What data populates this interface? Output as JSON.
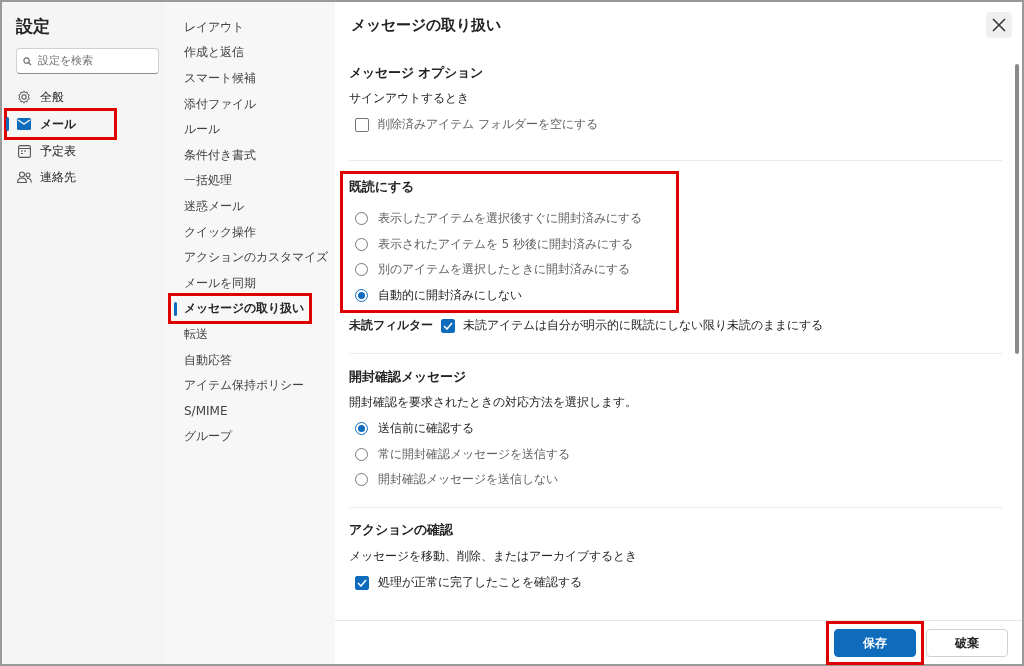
{
  "sidebar": {
    "title": "設定",
    "search": {
      "placeholder": "設定を検索"
    },
    "items": [
      {
        "label": "全般",
        "selected": false,
        "highlighted": false
      },
      {
        "label": "メール",
        "selected": true,
        "highlighted": true
      },
      {
        "label": "予定表",
        "selected": false,
        "highlighted": false
      },
      {
        "label": "連絡先",
        "selected": false,
        "highlighted": false
      }
    ]
  },
  "subnav": {
    "items": [
      {
        "label": "レイアウト",
        "selected": false,
        "highlighted": false
      },
      {
        "label": "作成と返信",
        "selected": false,
        "highlighted": false
      },
      {
        "label": "スマート候補",
        "selected": false,
        "highlighted": false
      },
      {
        "label": "添付ファイル",
        "selected": false,
        "highlighted": false
      },
      {
        "label": "ルール",
        "selected": false,
        "highlighted": false
      },
      {
        "label": "条件付き書式",
        "selected": false,
        "highlighted": false
      },
      {
        "label": "一括処理",
        "selected": false,
        "highlighted": false
      },
      {
        "label": "迷惑メール",
        "selected": false,
        "highlighted": false
      },
      {
        "label": "クイック操作",
        "selected": false,
        "highlighted": false
      },
      {
        "label": "アクションのカスタマイズ",
        "selected": false,
        "highlighted": false
      },
      {
        "label": "メールを同期",
        "selected": false,
        "highlighted": false
      },
      {
        "label": "メッセージの取り扱い",
        "selected": true,
        "highlighted": true
      },
      {
        "label": "転送",
        "selected": false,
        "highlighted": false
      },
      {
        "label": "自動応答",
        "selected": false,
        "highlighted": false
      },
      {
        "label": "アイテム保持ポリシー",
        "selected": false,
        "highlighted": false
      },
      {
        "label": "S/MIME",
        "selected": false,
        "highlighted": false
      },
      {
        "label": "グループ",
        "selected": false,
        "highlighted": false
      }
    ]
  },
  "panel": {
    "title": "メッセージの取り扱い",
    "sections": [
      {
        "title": "メッセージ オプション",
        "highlighted": false,
        "items": [
          {
            "kind": "label",
            "label": "サインアウトするとき"
          },
          {
            "kind": "checkbox",
            "label": "削除済みアイテム フォルダーを空にする",
            "checked": false
          }
        ]
      },
      {
        "title": "既読にする",
        "highlighted": true,
        "items": [
          {
            "kind": "radio",
            "label": "表示したアイテムを選択後すぐに開封済みにする",
            "selected": false
          },
          {
            "kind": "radio",
            "label": "表示されたアイテムを 5 秒後に開封済みにする",
            "selected": false
          },
          {
            "kind": "radio",
            "label": "別のアイテムを選択したときに開封済みにする",
            "selected": false
          },
          {
            "kind": "radio",
            "label": "自動的に開封済みにしない",
            "selected": true
          }
        ],
        "after": [
          {
            "kind": "labeled_checkbox",
            "caption": "未読フィルター",
            "label": "未読アイテムは自分が明示的に既読にしない限り未読のままにする",
            "checked": true
          }
        ]
      },
      {
        "title": "開封確認メッセージ",
        "highlighted": false,
        "items": [
          {
            "kind": "label",
            "label": "開封確認を要求されたときの対応方法を選択します。"
          },
          {
            "kind": "radio",
            "label": "送信前に確認する",
            "selected": true
          },
          {
            "kind": "radio",
            "label": "常に開封確認メッセージを送信する",
            "selected": false
          },
          {
            "kind": "radio",
            "label": "開封確認メッセージを送信しない",
            "selected": false
          }
        ]
      },
      {
        "title": "アクションの確認",
        "highlighted": false,
        "items": [
          {
            "kind": "label",
            "label": "メッセージを移動、削除、またはアーカイブするとき"
          },
          {
            "kind": "checkbox",
            "label": "処理が正常に完了したことを確認する",
            "checked": true
          }
        ]
      }
    ]
  },
  "buttons": [
    {
      "label": "保存",
      "kind": "primary",
      "highlighted": true
    },
    {
      "label": "破棄",
      "kind": "secondary",
      "highlighted": false
    }
  ]
}
